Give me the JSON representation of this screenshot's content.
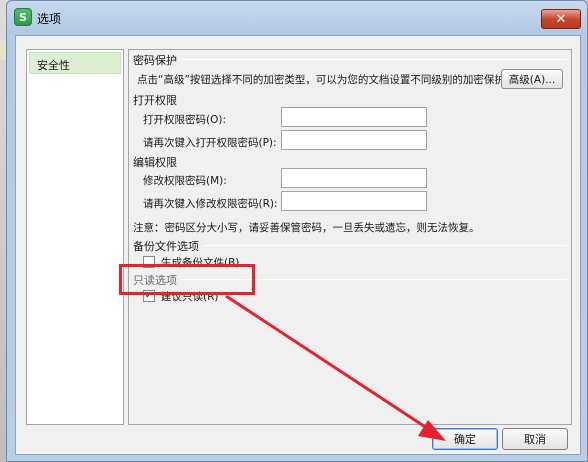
{
  "window": {
    "title": "选项",
    "app_icon_glyph": "S",
    "close_glyph": "✕"
  },
  "sidebar": {
    "items": [
      {
        "label": "安全性",
        "selected": true
      }
    ]
  },
  "password_protection": {
    "group_title": "密码保护",
    "description": "点击“高级”按钮选择不同的加密类型，可以为您的文档设置不同级别的加密保护。",
    "advanced_button": "高级(A)..."
  },
  "open_permission": {
    "group_title": "打开权限",
    "password_label": "打开权限密码(O):",
    "confirm_label": "请再次键入打开权限密码(P):",
    "password_value": "",
    "confirm_value": ""
  },
  "edit_permission": {
    "group_title": "编辑权限",
    "password_label": "修改权限密码(M):",
    "confirm_label": "请再次键入修改权限密码(R):",
    "password_value": "",
    "confirm_value": ""
  },
  "note": "注意：密码区分大小写，请妥善保管密码，一旦丢失或遗忘，则无法恢复。",
  "backup": {
    "group_title": "备份文件选项",
    "checkbox_label": "生成备份文件(B)",
    "checked": false
  },
  "readonly": {
    "group_title": "只读选项",
    "checkbox_label": "建议只读(R)",
    "checked": true,
    "check_glyph": "✓"
  },
  "footer": {
    "ok_label": "确定",
    "cancel_label": "取消"
  },
  "annotation": {
    "highlight_color": "#e3242b"
  }
}
